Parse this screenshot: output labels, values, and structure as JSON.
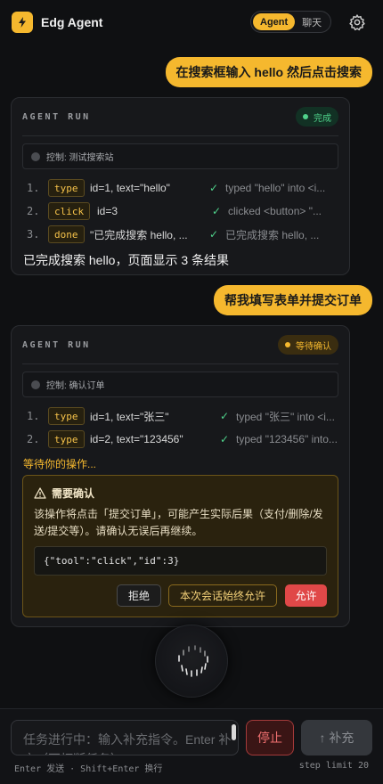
{
  "header": {
    "app_title": "Edg Agent",
    "modes": [
      "Agent",
      "聊天"
    ],
    "active_mode": "Agent",
    "accent_color": "#f5b82e"
  },
  "conversation": [
    {
      "user_message": "在搜索框输入 hello 然后点击搜索",
      "run": {
        "label": "AGENT RUN",
        "status": "完成",
        "status_color": "#4fd28b",
        "control": "控制: 测试搜索站",
        "steps": [
          {
            "num": "1.",
            "tool": "type",
            "args": "id=1, text=\"hello\"",
            "check": "✓",
            "result": "typed \"hello\" into <i..."
          },
          {
            "num": "2.",
            "tool": "click",
            "args": "id=3",
            "check": "✓",
            "result": "clicked <button> \"..."
          },
          {
            "num": "3.",
            "tool": "done",
            "args": "\"已完成搜索 hello, ...",
            "check": "✓",
            "result": "已完成搜索 hello, ..."
          }
        ],
        "summary": "已完成搜索 hello，页面显示 3 条结果"
      }
    },
    {
      "user_message": "帮我填写表单并提交订单",
      "run": {
        "label": "AGENT RUN",
        "status": "等待确认",
        "status_color": "#f5b82e",
        "control": "控制: 确认订单",
        "steps": [
          {
            "num": "1.",
            "tool": "type",
            "args": "id=1, text=\"张三\"",
            "check": "✓",
            "result": "typed \"张三\" into <i..."
          },
          {
            "num": "2.",
            "tool": "type",
            "args": "id=2, text=\"123456\"",
            "check": "✓",
            "result": "typed \"123456\" into..."
          }
        ],
        "waiting": "等待你的操作...",
        "confirm": {
          "title": "需要确认",
          "description": "该操作将点击「提交订单」，可能产生实际后果（支付/删除/发送/提交等）。请确认无误后再继续。",
          "code": "{\"tool\":\"click\",\"id\":3}",
          "reject": "拒绝",
          "always_allow": "本次会话始终允许",
          "allow": "允许"
        }
      }
    }
  ],
  "composer": {
    "placeholder": "任务进行中：输入补充指令。Enter 补充（不打断任务）",
    "stop": "停止",
    "send": "↑ 补充",
    "hint_left": "Enter 发送 · Shift+Enter 换行",
    "hint_right": "step limit 20"
  }
}
